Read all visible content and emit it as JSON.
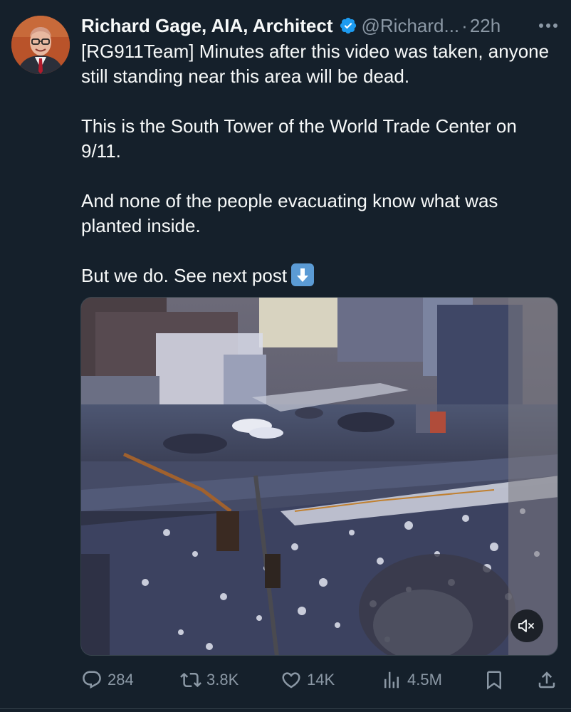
{
  "tweet": {
    "author_name": "Richard Gage, AIA, Architect",
    "handle": "@Richard...",
    "separator": "·",
    "time": "22h",
    "paragraphs": [
      "[RG911Team] Minutes after this video was taken, anyone still standing near this area will be dead.",
      "This is the South Tower of the World Trade Center on 9/11.",
      "And none of the people evacuating know what was planted inside.",
      "But we do. See next post"
    ]
  },
  "icons": {
    "verified": "verified-badge-icon",
    "more": "more-options-icon",
    "emoji": "down-arrow-emoji",
    "mute": "muted-speaker-icon"
  },
  "actions": {
    "replies": "284",
    "reposts": "3.8K",
    "likes": "14K",
    "views": "4.5M"
  },
  "colors": {
    "background": "#15202b",
    "text": "#f7f9f9",
    "secondary": "#8b98a5",
    "verified": "#1d9bf0",
    "border": "#38444d"
  }
}
